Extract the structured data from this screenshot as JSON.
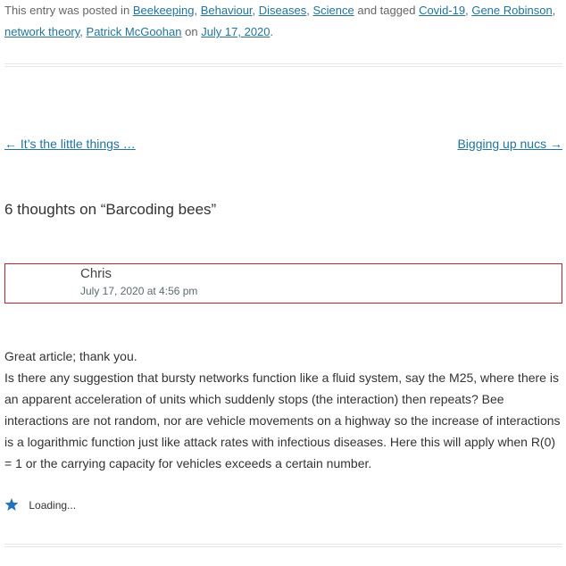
{
  "entry_meta": {
    "prefix": "This entry was posted in",
    "categories": [
      "Beekeeping",
      "Behaviour",
      "Diseases",
      "Science"
    ],
    "tagged_text": "and tagged",
    "tags": [
      "Covid-19",
      "Gene Robinson",
      "network theory",
      "Patrick McGoohan"
    ],
    "on_text": "on",
    "date": "July 17, 2020"
  },
  "post_nav": {
    "previous_label": "← It’s the little things …",
    "next_label": "Bigging up nucs →"
  },
  "comments": {
    "title": "6 thoughts on “Barcoding bees”",
    "items": [
      {
        "author": "Chris",
        "date": "July 17, 2020 at 4:56 pm",
        "paragraphs": [
          "Great article; thank you.",
          "Is there any suggestion that bursty networks function like a fluid system, say the M25, where there is an apparent acceleration of units which suddenly stops (the interaction) then repeats? Bee interactions are not random, nor are vehicle movements on a highway so the increase of interactions is a logarithmic function just like attack rates with infectious diseases. Here this will apply when R(0) = 1 or the carrying capacity for vehicles exceeds a certain number."
        ],
        "like_status": "Loading..."
      }
    ]
  },
  "colors": {
    "link": "#21759b",
    "author_box_border": "#b3262b",
    "star": "#1e73be"
  },
  "icons": {
    "like": "star-icon"
  }
}
